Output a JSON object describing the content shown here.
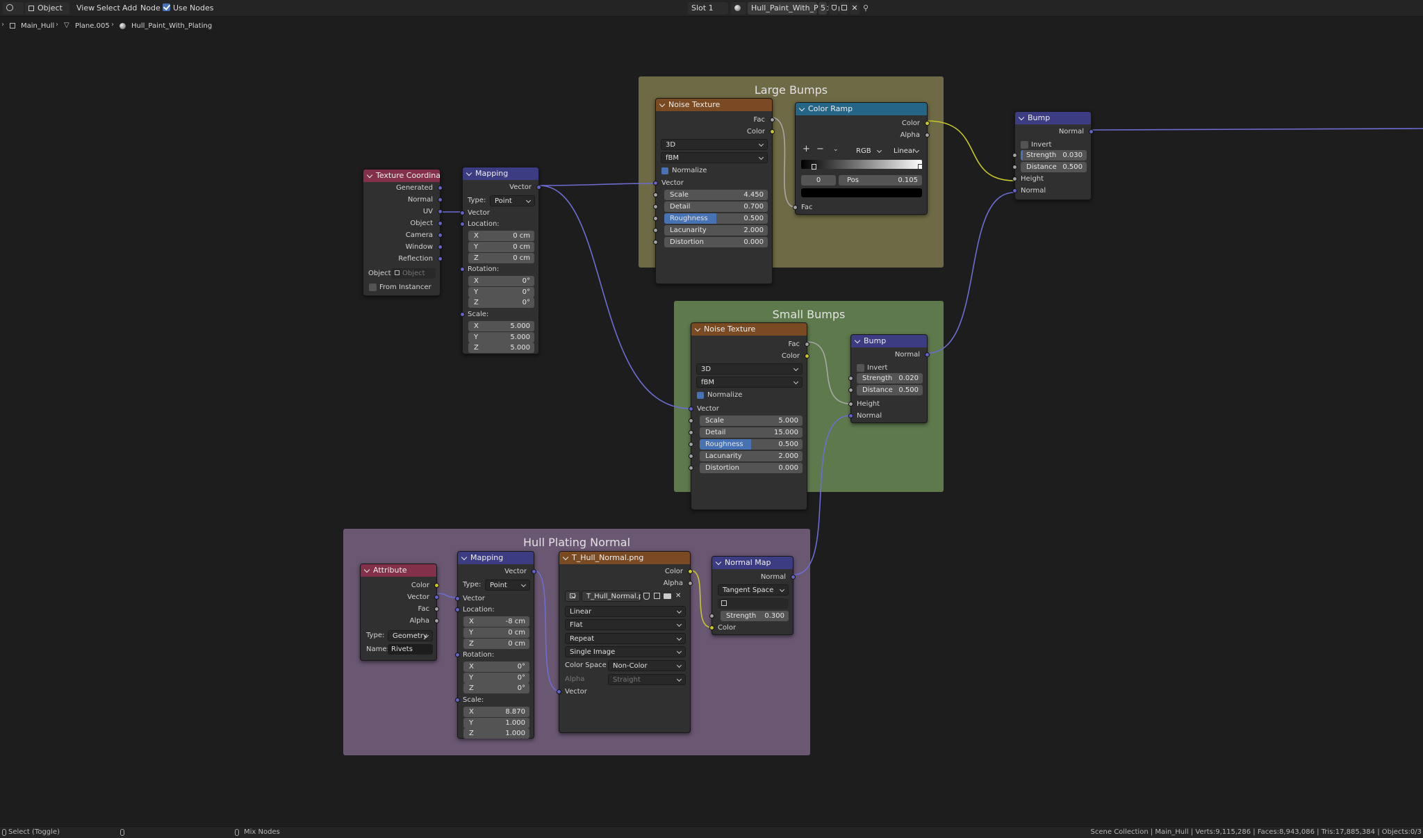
{
  "header": {
    "mode": "Object",
    "menus": [
      "View",
      "Select",
      "Add",
      "Node"
    ],
    "use_nodes_label": "Use Nodes",
    "slot": "Slot 1",
    "material_name": "Hull_Paint_With_Plating",
    "user_count": "5"
  },
  "breadcrumb": {
    "items": [
      "Main_Hull",
      "Plane.005",
      "Hull_Paint_With_Plating"
    ]
  },
  "frames": {
    "large": "Large Bumps",
    "small": "Small Bumps",
    "hull": "Hull Plating Normal",
    "colors": {
      "large": "#6e6a45",
      "small": "#5e7a4c",
      "hull": "#6a5772"
    }
  },
  "tex_coord": {
    "title": "Texture Coordinate",
    "outputs": [
      "Generated",
      "Normal",
      "UV",
      "Object",
      "Camera",
      "Window",
      "Reflection"
    ],
    "object_label": "Object:",
    "object_placeholder": "Object",
    "from_instancer": "From Instancer"
  },
  "mapping1": {
    "title": "Mapping",
    "output": "Vector",
    "type_label": "Type:",
    "type_value": "Point",
    "vector": "Vector",
    "location": "Location:",
    "loc": [
      [
        "X",
        "0 cm"
      ],
      [
        "Y",
        "0 cm"
      ],
      [
        "Z",
        "0 cm"
      ]
    ],
    "rotation": "Rotation:",
    "rot": [
      [
        "X",
        "0°"
      ],
      [
        "Y",
        "0°"
      ],
      [
        "Z",
        "0°"
      ]
    ],
    "scale": "Scale:",
    "scl": [
      [
        "X",
        "5.000"
      ],
      [
        "Y",
        "5.000"
      ],
      [
        "Z",
        "5.000"
      ]
    ]
  },
  "noise1": {
    "title": "Noise Texture",
    "fac": "Fac",
    "color": "Color",
    "dims": "3D",
    "type": "fBM",
    "normalize": "Normalize",
    "vector": "Vector",
    "params": [
      [
        "Scale",
        "4.450"
      ],
      [
        "Detail",
        "0.700"
      ],
      [
        "Roughness",
        "0.500"
      ],
      [
        "Lacunarity",
        "2.000"
      ],
      [
        "Distortion",
        "0.000"
      ]
    ],
    "roughness_fill": 0.5
  },
  "ramp": {
    "title": "Color Ramp",
    "color": "Color",
    "alpha": "Alpha",
    "mode": "RGB",
    "interp": "Linear",
    "index": "0",
    "pos_label": "Pos",
    "pos_value": "0.105",
    "fac": "Fac"
  },
  "bump1": {
    "title": "Bump",
    "normal_out": "Normal",
    "invert": "Invert",
    "strength_label": "Strength",
    "strength": "0.030",
    "strength_fill": 0.03,
    "distance_label": "Distance",
    "distance": "0.500",
    "height": "Height",
    "normal_in": "Normal"
  },
  "noise2": {
    "title": "Noise Texture",
    "fac": "Fac",
    "color": "Color",
    "dims": "3D",
    "type": "fBM",
    "normalize": "Normalize",
    "vector": "Vector",
    "params": [
      [
        "Scale",
        "5.000"
      ],
      [
        "Detail",
        "15.000"
      ],
      [
        "Roughness",
        "0.500"
      ],
      [
        "Lacunarity",
        "2.000"
      ],
      [
        "Distortion",
        "0.000"
      ]
    ],
    "roughness_fill": 0.5
  },
  "bump2": {
    "title": "Bump",
    "normal_out": "Normal",
    "invert": "Invert",
    "strength_label": "Strength",
    "strength": "0.020",
    "distance_label": "Distance",
    "distance": "0.500",
    "height": "Height",
    "normal_in": "Normal"
  },
  "attribute": {
    "title": "Attribute",
    "outputs": [
      "Color",
      "Vector",
      "Fac",
      "Alpha"
    ],
    "type_label": "Type:",
    "type_value": "Geometry",
    "name_label": "Name:",
    "name_value": "Rivets"
  },
  "mapping2": {
    "title": "Mapping",
    "output": "Vector",
    "type_label": "Type:",
    "type_value": "Point",
    "vector": "Vector",
    "location": "Location:",
    "loc": [
      [
        "X",
        "-8 cm"
      ],
      [
        "Y",
        "0 cm"
      ],
      [
        "Z",
        "0 cm"
      ]
    ],
    "rotation": "Rotation:",
    "rot": [
      [
        "X",
        "0°"
      ],
      [
        "Y",
        "0°"
      ],
      [
        "Z",
        "0°"
      ]
    ],
    "scale": "Scale:",
    "scl": [
      [
        "X",
        "8.870"
      ],
      [
        "Y",
        "1.000"
      ],
      [
        "Z",
        "1.000"
      ]
    ]
  },
  "image_tex": {
    "title": "T_Hull_Normal.png",
    "color": "Color",
    "alpha": "Alpha",
    "image_name": "T_Hull_Normal.p...",
    "interpolation": "Linear",
    "projection": "Flat",
    "extension": "Repeat",
    "source": "Single Image",
    "colorspace_label": "Color Space",
    "colorspace": "Non-Color",
    "alpha_label": "Alpha",
    "alpha_mode": "Straight",
    "vector": "Vector"
  },
  "normal_map": {
    "title": "Normal Map",
    "normal": "Normal",
    "space": "Tangent Space",
    "strength_label": "Strength",
    "strength": "0.300",
    "color": "Color"
  },
  "status": {
    "left": "Select (Toggle)",
    "middle": "Mix Nodes",
    "right": "Scene Collection | Main_Hull | Verts:9,115,286 | Faces:8,943,086 | Tris:17,885,384 | Objects:0/3"
  }
}
